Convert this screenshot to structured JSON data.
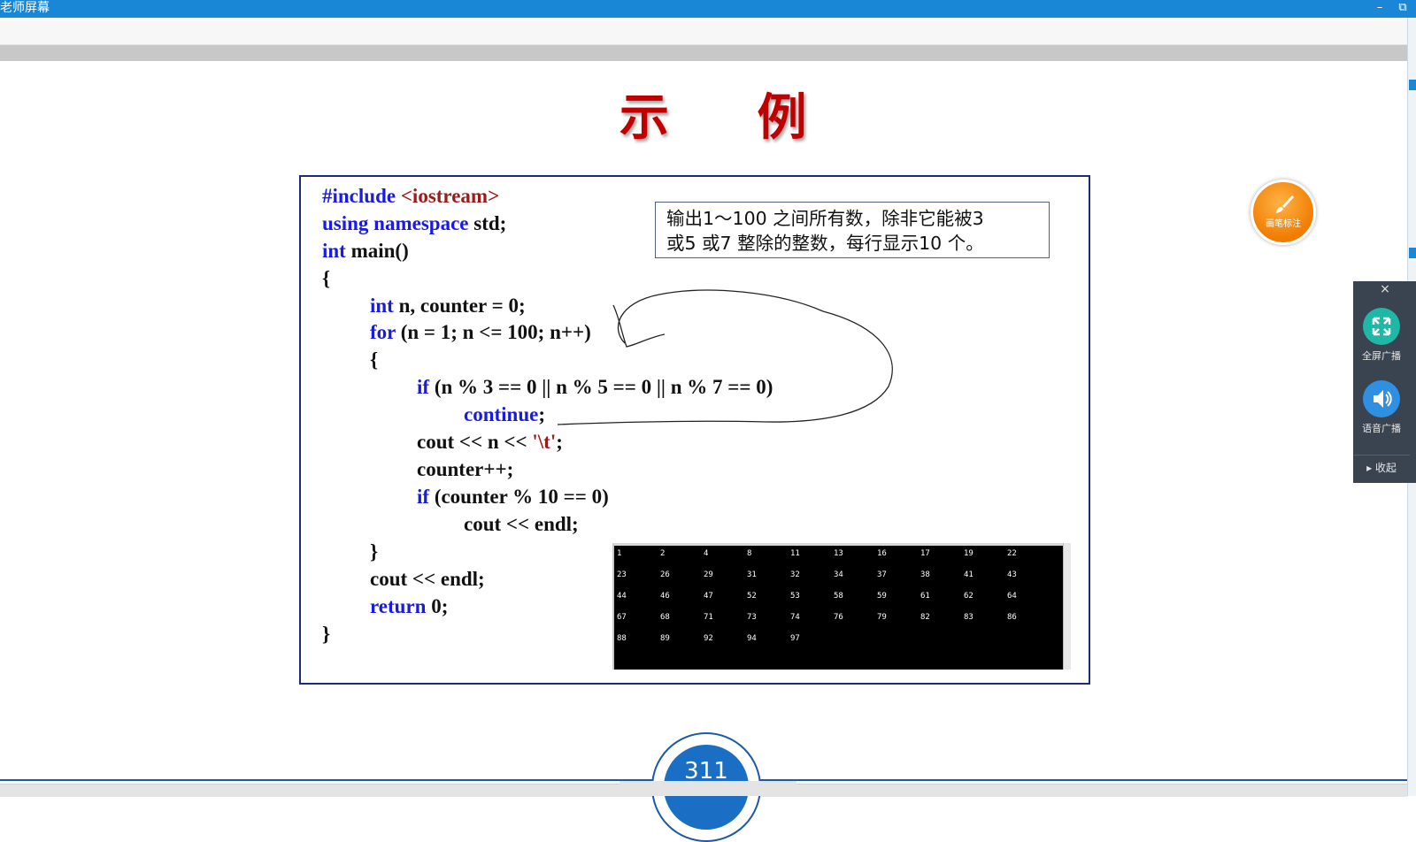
{
  "window": {
    "title": "老师屏幕",
    "minimize_label": "–",
    "restore_label": "⧉"
  },
  "slide": {
    "title": "示 例",
    "page_number": "311",
    "description_line1": "输出1～100 之间所有数，除非它能被3",
    "description_line2": "或5 或7 整除的整数，每行显示10 个。",
    "code": {
      "l1_kw": "#include",
      "l1_rest": " <iostream>",
      "l2_kw": "using namespace",
      "l2_rest": " std;",
      "l3_kw": "int",
      "l3_rest": " main()",
      "l4": "{",
      "l5_kw": "int",
      "l5_rest": " n, counter = 0;",
      "l6_kw": "for",
      "l6_rest": " (n = 1; n <= 100; n++)",
      "l7": "{",
      "l8_kw": "if",
      "l8_rest": " (n % 3 == 0 || n % 5 == 0 || n % 7 == 0)",
      "l9_kw": "continue",
      "l9_rest": ";",
      "l10_a": "cout << n << ",
      "l10_str": "'\\t'",
      "l10_b": ";",
      "l11": "counter++;",
      "l12_kw": "if",
      "l12_rest": " (counter % 10 == 0)",
      "l13": "cout << endl;",
      "l14": "}",
      "l15": "cout << endl;",
      "l16_kw": "return",
      "l16_rest": " 0;",
      "l17": "}"
    },
    "console_output": [
      [
        "1",
        "2",
        "4",
        "8",
        "11",
        "13",
        "16",
        "17",
        "19",
        "22"
      ],
      [
        "23",
        "26",
        "29",
        "31",
        "32",
        "34",
        "37",
        "38",
        "41",
        "43"
      ],
      [
        "44",
        "46",
        "47",
        "52",
        "53",
        "58",
        "59",
        "61",
        "62",
        "64"
      ],
      [
        "67",
        "68",
        "71",
        "73",
        "74",
        "76",
        "79",
        "82",
        "83",
        "86"
      ],
      [
        "88",
        "89",
        "92",
        "94",
        "97"
      ]
    ]
  },
  "pen_tool": {
    "label": "画笔标注",
    "icon": "brush-icon"
  },
  "broadcast_panel": {
    "close_label": "×",
    "fullscreen_label": "全屏广播",
    "fullscreen_icon": "expand-icon",
    "voice_label": "语音广播",
    "voice_icon": "speaker-icon",
    "collapse_label": "▸  收起"
  },
  "colors": {
    "titlebar": "#1a86d6",
    "slide_title": "#c00000",
    "keyword": "#1a1ae6",
    "string_literal": "#9b1a1a",
    "pen_button": "#f07c00",
    "panel_bg": "#3a4350",
    "fullscreen_button": "#1fb7a6",
    "voice_button": "#2f8fe0",
    "page_badge": "#1a6fc4"
  }
}
